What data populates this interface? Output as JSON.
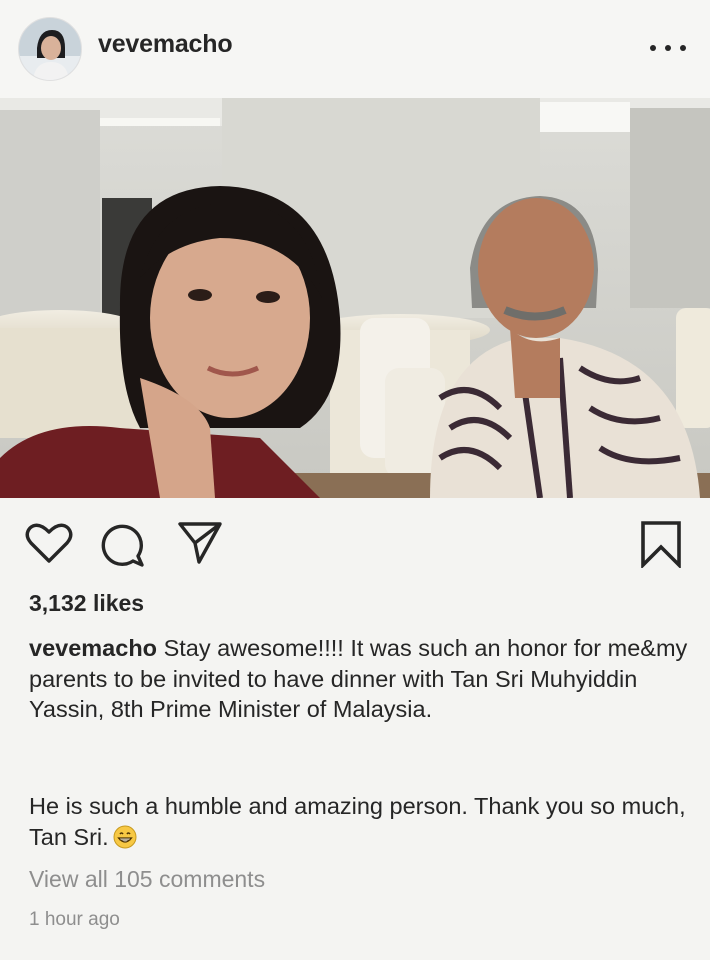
{
  "post": {
    "username": "vevemacho",
    "more_icon": "more-horizontal-icon",
    "photo_alt": "Photo",
    "actions": {
      "like_icon": "heart-icon",
      "comment_icon": "comment-icon",
      "share_icon": "send-icon",
      "save_icon": "bookmark-icon"
    },
    "likes": "3,132 likes",
    "caption": {
      "username": "vevemacho",
      "line1": "Stay awesome!!!! It was such an honor for me&my parents to be invited to have dinner with Tan Sri Muhyiddin Yassin, 8th Prime Minister of Malaysia.",
      "line2": "He is such a humble and amazing person. Thank you so much, Tan Sri.",
      "emoji": "grinning-face-emoji"
    },
    "view_comments": "View all 105 comments",
    "timestamp": "1 hour ago"
  },
  "colors": {
    "text": "#262626",
    "secondary_text": "#8e8e8e",
    "background": "#f4f4f2"
  }
}
